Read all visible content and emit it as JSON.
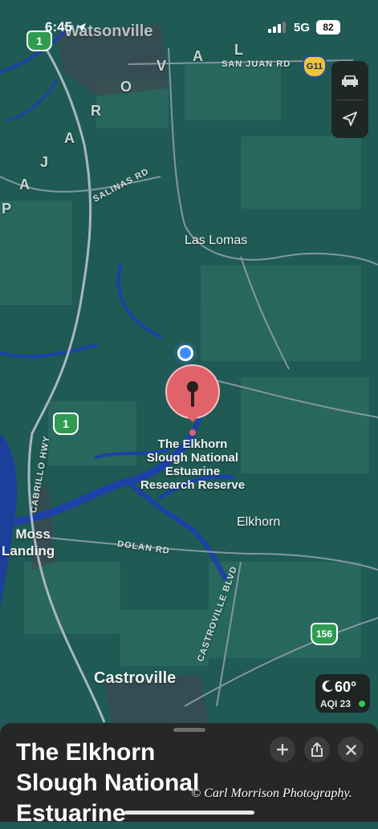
{
  "status_bar": {
    "time": "6:45",
    "network": "5G",
    "battery": "82"
  },
  "map": {
    "places": {
      "watsonville": "Watsonville",
      "las_lomas": "Las Lomas",
      "elkhorn": "Elkhorn",
      "moss_landing_1": "Moss",
      "moss_landing_2": "Landing",
      "castroville": "Castroville"
    },
    "roads": {
      "san_juan": "SAN JUAN RD",
      "salinas": "SALINAS RD",
      "cabrillo": "CABRILLO HWY",
      "dolan": "DOLAN RD",
      "castroville_blvd": "CASTROVILLE BLVD"
    },
    "route_shields": {
      "hwy1_top": "1",
      "hwy1_mid": "1",
      "g11": "G11",
      "r156": "156"
    },
    "region_letters": [
      "P",
      "A",
      "J",
      "A",
      "R",
      "O",
      "V",
      "A",
      "L"
    ],
    "pin_label": [
      "The Elkhorn",
      "Slough National",
      "Estuarine",
      "Research Reserve"
    ],
    "colors": {
      "land": "#1f5a55",
      "water": "#1b3f9a",
      "pin": "#e0636b",
      "roads": "#9aa9b7"
    }
  },
  "controls": {
    "drive_icon": "car-icon",
    "locate_icon": "location-arrow-icon"
  },
  "weather": {
    "temperature": "60°",
    "aqi": "AQI 23",
    "icon": "moon-icon"
  },
  "sheet": {
    "title_lines": [
      "The Elkhorn",
      "Slough National",
      "Estuarine"
    ],
    "actions": [
      "plus-icon",
      "share-icon",
      "close-icon"
    ]
  },
  "watermark": "© Carl Morrison Photography."
}
